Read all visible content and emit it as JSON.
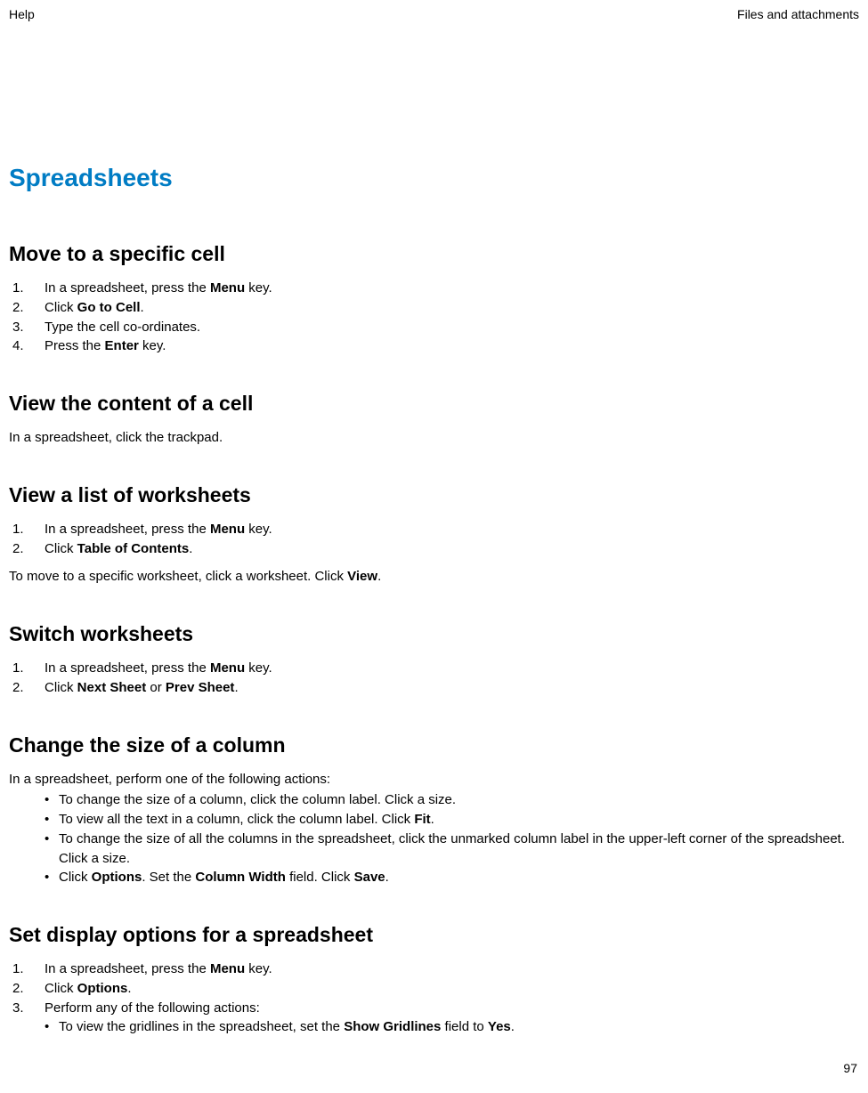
{
  "header": {
    "left": "Help",
    "right": "Files and attachments"
  },
  "page_number": "97",
  "title": "Spreadsheets",
  "sections": {
    "moveCell": {
      "heading": "Move to a specific cell",
      "steps": {
        "s1a": "In a spreadsheet, press the ",
        "s1b": "Menu",
        "s1c": " key.",
        "s2a": "Click ",
        "s2b": "Go to Cell",
        "s2c": ".",
        "s3": "Type the cell co-ordinates.",
        "s4a": "Press the ",
        "s4b": "Enter",
        "s4c": " key."
      }
    },
    "viewContent": {
      "heading": "View the content of a cell",
      "body": "In a spreadsheet, click the trackpad."
    },
    "listWorksheets": {
      "heading": "View a list of worksheets",
      "steps": {
        "s1a": "In a spreadsheet, press the ",
        "s1b": "Menu",
        "s1c": " key.",
        "s2a": "Click ",
        "s2b": "Table of Contents",
        "s2c": "."
      },
      "noteA": "To move to a specific worksheet, click a worksheet. Click ",
      "noteB": "View",
      "noteC": "."
    },
    "switch": {
      "heading": "Switch worksheets",
      "steps": {
        "s1a": "In a spreadsheet, press the ",
        "s1b": "Menu",
        "s1c": " key.",
        "s2a": "Click ",
        "s2b": "Next Sheet",
        "s2c": " or ",
        "s2d": "Prev Sheet",
        "s2e": "."
      }
    },
    "colSize": {
      "heading": "Change the size of a column",
      "intro": "In a spreadsheet, perform one of the following actions:",
      "bullets": {
        "b1": "To change the size of a column, click the column label. Click a size.",
        "b2a": "To view all the text in a column, click the column label. Click ",
        "b2b": "Fit",
        "b2c": ".",
        "b3": "To change the size of all the columns in the spreadsheet, click the unmarked column label in the upper-left corner of the spreadsheet. Click a size.",
        "b4a": "Click ",
        "b4b": "Options",
        "b4c": ". Set the ",
        "b4d": "Column Width",
        "b4e": " field. Click ",
        "b4f": "Save",
        "b4g": "."
      }
    },
    "display": {
      "heading": "Set display options for a spreadsheet",
      "steps": {
        "s1a": "In a spreadsheet, press the ",
        "s1b": "Menu",
        "s1c": " key.",
        "s2a": "Click ",
        "s2b": "Options",
        "s2c": ".",
        "s3": "Perform any of the following actions:"
      },
      "bullets": {
        "b1a": "To view the gridlines in the spreadsheet, set the ",
        "b1b": "Show Gridlines",
        "b1c": " field to ",
        "b1d": "Yes",
        "b1e": "."
      }
    }
  }
}
